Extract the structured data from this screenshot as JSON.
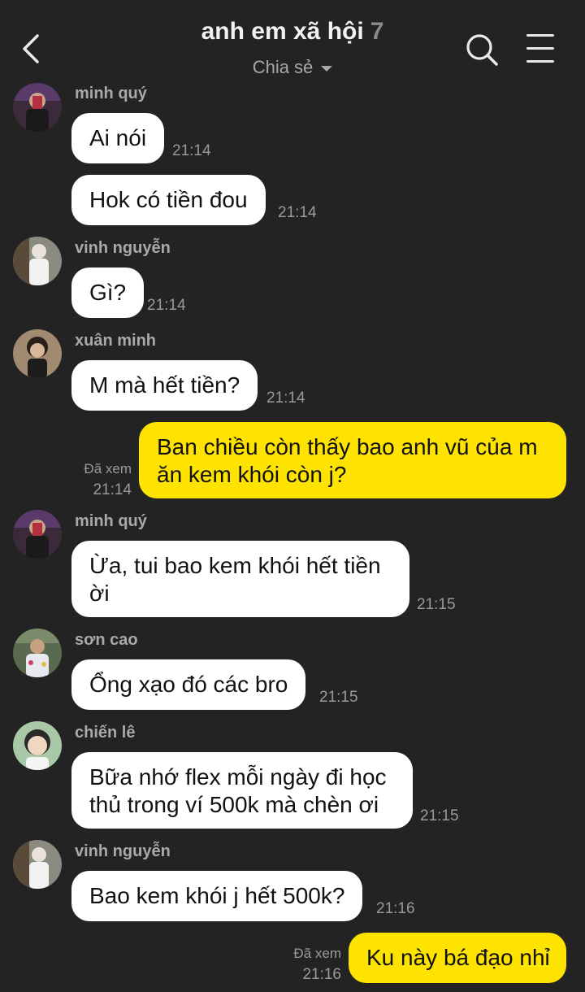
{
  "header": {
    "title": "anh em xã hội",
    "member_count": "7",
    "subtitle": "Chia sẻ"
  },
  "messages": [
    {
      "sender": "minh quý",
      "text": "Ai nói",
      "time": "21:14"
    },
    {
      "text": "Hok có tiền đou",
      "time": "21:14"
    },
    {
      "sender": "vinh nguyễn",
      "text": "Gì?",
      "time": "21:14"
    },
    {
      "sender": "xuân minh",
      "text": "M mà hết tiền?",
      "time": "21:14"
    },
    {
      "mine": true,
      "text": "Ban chiều còn thấy bao anh vũ của m ăn kem khói còn j?",
      "seen": "Đã xem",
      "time": "21:14"
    },
    {
      "sender": "minh quý",
      "text": "Ừa, tui bao kem khói hết tiền ời",
      "time": "21:15"
    },
    {
      "sender": "sơn cao",
      "text": "Ổng xạo đó các bro",
      "time": "21:15"
    },
    {
      "sender": "chiến lê",
      "text": "Bữa nhớ flex mỗi ngày đi học thủ trong ví 500k mà chèn ơi",
      "time": "21:15"
    },
    {
      "sender": "vinh nguyễn",
      "text": "Bao kem khói j hết 500k?",
      "time": "21:16"
    },
    {
      "mine": true,
      "text": "Ku này bá đạo nhỉ",
      "seen": "Đã xem",
      "time": "21:16"
    }
  ],
  "colors": {
    "background": "#232323",
    "incoming_bubble": "#ffffff",
    "outgoing_bubble": "#ffe300"
  }
}
